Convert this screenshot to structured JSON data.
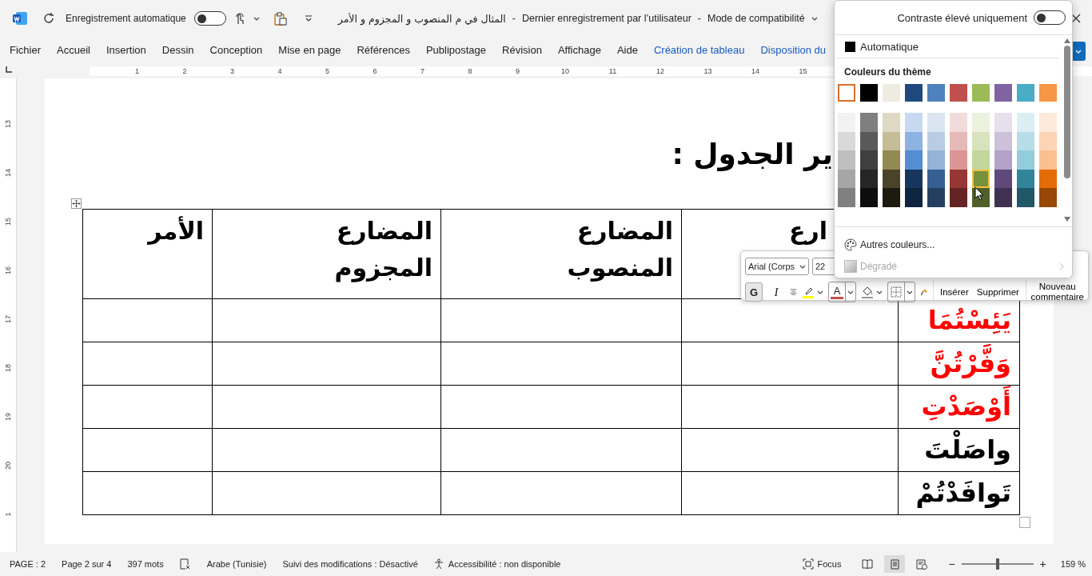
{
  "title_bar": {
    "autosave": {
      "label": "Enregistrement automatique",
      "on": false
    },
    "title_parts": [
      "المثال في م المنصوب و المجزوم و الأمر",
      "-",
      "Dernier enregistrement par l’utilisateur",
      "-",
      "Mode de compatibilité"
    ]
  },
  "ribbon_tabs": [
    {
      "label": "Fichier",
      "selected": false,
      "kind": "standard"
    },
    {
      "label": "Accueil",
      "selected": false,
      "kind": "standard"
    },
    {
      "label": "Insertion",
      "selected": false,
      "kind": "standard"
    },
    {
      "label": "Dessin",
      "selected": false,
      "kind": "standard"
    },
    {
      "label": "Conception",
      "selected": false,
      "kind": "standard"
    },
    {
      "label": "Mise en page",
      "selected": false,
      "kind": "standard"
    },
    {
      "label": "Références",
      "selected": false,
      "kind": "standard"
    },
    {
      "label": "Publipostage",
      "selected": false,
      "kind": "standard"
    },
    {
      "label": "Révision",
      "selected": false,
      "kind": "standard"
    },
    {
      "label": "Affichage",
      "selected": false,
      "kind": "standard"
    },
    {
      "label": "Aide",
      "selected": false,
      "kind": "standard"
    },
    {
      "label": "Création de tableau",
      "selected": false,
      "kind": "contextual"
    },
    {
      "label": "Disposition du",
      "selected": false,
      "kind": "contextual"
    }
  ],
  "ruler": {
    "horizontal": [
      "1",
      "2",
      "3",
      "4",
      "5",
      "6",
      "7",
      "8",
      "9",
      "10",
      "11",
      "12",
      "13",
      "14",
      "15"
    ],
    "vertical": [
      "13",
      "14",
      "15",
      "16",
      "17",
      "18",
      "19",
      "20",
      "1"
    ]
  },
  "document": {
    "heading": "ير الجدول :",
    "header_cells": [
      {
        "lines": [
          "ارع"
        ]
      },
      {
        "lines": [
          "المضارع",
          "المنصوب"
        ]
      },
      {
        "lines": [
          "المضارع",
          "المجزوم"
        ]
      },
      {
        "lines": [
          "الأمر"
        ]
      }
    ],
    "rows": [
      {
        "word": "يَئِسْتُمَا",
        "color": "#ff0000"
      },
      {
        "word": "وَفَّرْتُنَّ",
        "color": "#ff0000"
      },
      {
        "word": "أَوْصَدْتِ",
        "color": "#ff0000"
      },
      {
        "word": "واصَلْتَ",
        "color": "#000000"
      },
      {
        "word": "تَوافَدْتُمْ",
        "color": "#000000"
      }
    ]
  },
  "mini_toolbar": {
    "font": "Arial (Corps",
    "size": "22",
    "bold_label": "G",
    "bold_active": true,
    "italic_label": "I",
    "font_color_label": "A",
    "actions": [
      "Insérer",
      "Supprimer"
    ],
    "comment": "Nouveau commentaire"
  },
  "color_menu": {
    "high_contrast": {
      "label": "Contraste élevé uniquement",
      "on": false
    },
    "automatic": "Automatique",
    "section": "Couleurs du thème",
    "theme_colors": [
      {
        "color": "#ffffff",
        "selected": true
      },
      {
        "color": "#000000",
        "selected": false
      },
      {
        "color": "#eeece1",
        "selected": false
      },
      {
        "color": "#1f497d",
        "selected": false
      },
      {
        "color": "#4f81bd",
        "selected": false
      },
      {
        "color": "#c0504d",
        "selected": false
      },
      {
        "color": "#9bbb59",
        "selected": false
      },
      {
        "color": "#8064a2",
        "selected": false
      },
      {
        "color": "#4bacc6",
        "selected": false
      },
      {
        "color": "#f79646",
        "selected": false
      }
    ],
    "shades": [
      [
        {
          "color": "#f2f2f2",
          "highlighted": false
        },
        {
          "color": "#d9d9d9",
          "highlighted": false
        },
        {
          "color": "#bfbfbf",
          "highlighted": false
        },
        {
          "color": "#a6a6a6",
          "highlighted": false
        },
        {
          "color": "#808080",
          "highlighted": false
        }
      ],
      [
        {
          "color": "#7f7f7f",
          "highlighted": false
        },
        {
          "color": "#595959",
          "highlighted": false
        },
        {
          "color": "#3f3f3f",
          "highlighted": false
        },
        {
          "color": "#262626",
          "highlighted": false
        },
        {
          "color": "#0d0d0d",
          "highlighted": false
        }
      ],
      [
        {
          "color": "#ddd9c3",
          "highlighted": false
        },
        {
          "color": "#c4bd97",
          "highlighted": false
        },
        {
          "color": "#938953",
          "highlighted": false
        },
        {
          "color": "#494429",
          "highlighted": false
        },
        {
          "color": "#1d1b10",
          "highlighted": false
        }
      ],
      [
        {
          "color": "#c6d9f0",
          "highlighted": false
        },
        {
          "color": "#8db3e2",
          "highlighted": false
        },
        {
          "color": "#548dd4",
          "highlighted": false
        },
        {
          "color": "#17365d",
          "highlighted": false
        },
        {
          "color": "#0f243e",
          "highlighted": false
        }
      ],
      [
        {
          "color": "#dbe5f1",
          "highlighted": false
        },
        {
          "color": "#b8cce4",
          "highlighted": false
        },
        {
          "color": "#95b3d7",
          "highlighted": false
        },
        {
          "color": "#366092",
          "highlighted": false
        },
        {
          "color": "#244061",
          "highlighted": false
        }
      ],
      [
        {
          "color": "#f2dcdb",
          "highlighted": false
        },
        {
          "color": "#e5b9b7",
          "highlighted": false
        },
        {
          "color": "#d99694",
          "highlighted": false
        },
        {
          "color": "#953734",
          "highlighted": false
        },
        {
          "color": "#632423",
          "highlighted": false
        }
      ],
      [
        {
          "color": "#ebf1dd",
          "highlighted": false
        },
        {
          "color": "#d7e3bc",
          "highlighted": false
        },
        {
          "color": "#c3d69b",
          "highlighted": false
        },
        {
          "color": "#76923c",
          "highlighted": true
        },
        {
          "color": "#4f6128",
          "highlighted": false
        }
      ],
      [
        {
          "color": "#e5e0ec",
          "highlighted": false
        },
        {
          "color": "#ccc1d9",
          "highlighted": false
        },
        {
          "color": "#b2a2c7",
          "highlighted": false
        },
        {
          "color": "#5f497a",
          "highlighted": false
        },
        {
          "color": "#3f3151",
          "highlighted": false
        }
      ],
      [
        {
          "color": "#dbeef3",
          "highlighted": false
        },
        {
          "color": "#b7dde8",
          "highlighted": false
        },
        {
          "color": "#92cddc",
          "highlighted": false
        },
        {
          "color": "#31859b",
          "highlighted": false
        },
        {
          "color": "#205867",
          "highlighted": false
        }
      ],
      [
        {
          "color": "#fdeada",
          "highlighted": false
        },
        {
          "color": "#fbd5b5",
          "highlighted": false
        },
        {
          "color": "#fac08f",
          "highlighted": false
        },
        {
          "color": "#e36c09",
          "highlighted": false
        },
        {
          "color": "#974806",
          "highlighted": false
        }
      ]
    ],
    "more_colors": "Autres couleurs...",
    "gradient": {
      "label": "Dégradé",
      "disabled": true
    }
  },
  "status_bar": {
    "items": [
      "PAGE : 2",
      "Page 2 sur 4",
      "397 mots"
    ],
    "language": "Arabe (Tunisie)",
    "track_changes": "Suivi des modifications : Désactivé",
    "accessibility": "Accessibilité : non disponible",
    "focus": "Focus",
    "views": [
      {
        "kind": "read",
        "selected": false
      },
      {
        "kind": "print",
        "selected": true
      },
      {
        "kind": "web",
        "selected": false
      }
    ],
    "zoom": {
      "minus": "−",
      "plus": "+",
      "level": 0.5,
      "reading": "159 %"
    }
  }
}
